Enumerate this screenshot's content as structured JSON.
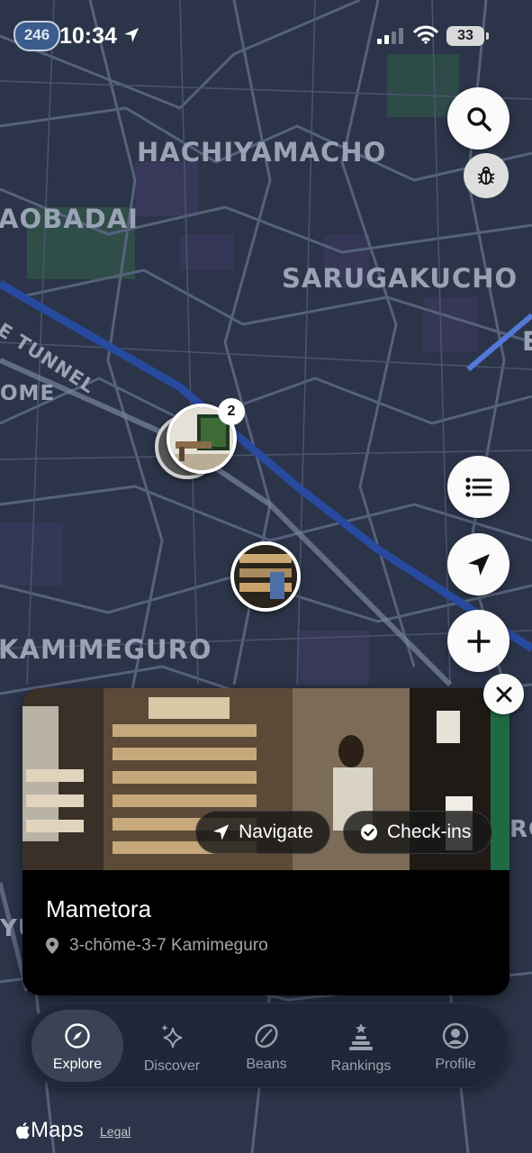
{
  "map": {
    "districts": [
      "HACHIYAMACHO",
      "AOBADAI",
      "SARUGAKUCHO",
      "OME",
      "KAMIMEGURO"
    ],
    "road_label": "E TUNNEL",
    "edge_label_right_1": "E",
    "edge_label_right_2": "RO",
    "edge_label_left": "YU",
    "cluster_pin": {
      "count": "2"
    },
    "colors": {
      "background": "#2b3448",
      "road": "#5d6a86",
      "major_road": "#27499e",
      "park": "#2f5547",
      "label": "#9aa3b6"
    }
  },
  "status_bar": {
    "route_badge": "246",
    "time": "10:34",
    "battery": "33"
  },
  "controls": {
    "search": "search-icon",
    "debug": "bug-icon",
    "list": "list-icon",
    "locate": "location-arrow-icon",
    "add": "plus-icon",
    "close": "close-icon"
  },
  "card": {
    "title": "Mametora",
    "address": "3-chōme-3-7 Kamimeguro",
    "navigate_label": "Navigate",
    "checkins_label": "Check-ins"
  },
  "tabs": [
    {
      "label": "Explore",
      "icon": "compass-icon",
      "active": true
    },
    {
      "label": "Discover",
      "icon": "sparkles-icon",
      "active": false
    },
    {
      "label": "Beans",
      "icon": "coffee-bean-icon",
      "active": false
    },
    {
      "label": "Rankings",
      "icon": "podium-icon",
      "active": false
    },
    {
      "label": "Profile",
      "icon": "person-icon",
      "active": false
    }
  ],
  "footer": {
    "maps_brand": "Maps",
    "legal": "Legal"
  }
}
